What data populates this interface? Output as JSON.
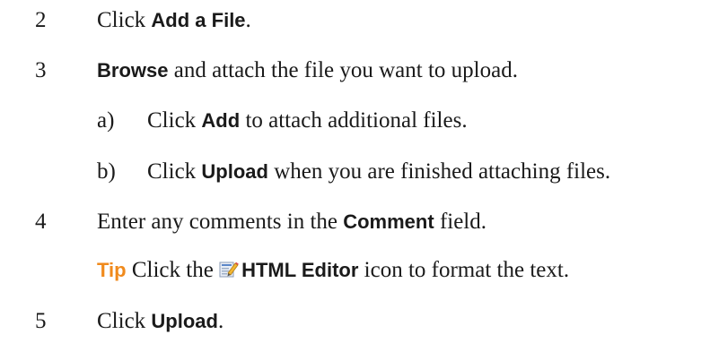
{
  "steps": [
    {
      "number": "2",
      "parts": {
        "a": "Click ",
        "b": "Add a File",
        "c": "."
      }
    },
    {
      "number": "3",
      "parts": {
        "a": "Browse",
        "b": " and attach the file you want to upload."
      }
    },
    {
      "number": "4",
      "parts": {
        "a": "Enter any comments in the ",
        "b": "Comment",
        "c": " field."
      }
    },
    {
      "number": "5",
      "parts": {
        "a": "Click ",
        "b": "Upload",
        "c": "."
      }
    }
  ],
  "substeps": [
    {
      "letter": "a)",
      "parts": {
        "a": "Click ",
        "b": "Add",
        "c": " to attach additional files."
      }
    },
    {
      "letter": "b)",
      "parts": {
        "a": "Click ",
        "b": "Upload",
        "c": " when you are finished attaching files."
      }
    }
  ],
  "tip": {
    "label": "Tip",
    "before": " Click the ",
    "icon": "html-editor-icon",
    "ui": "HTML Editor",
    "after": " icon to format the text."
  },
  "colors": {
    "tip": "#f08a1c",
    "text": "#1a1a1a"
  }
}
